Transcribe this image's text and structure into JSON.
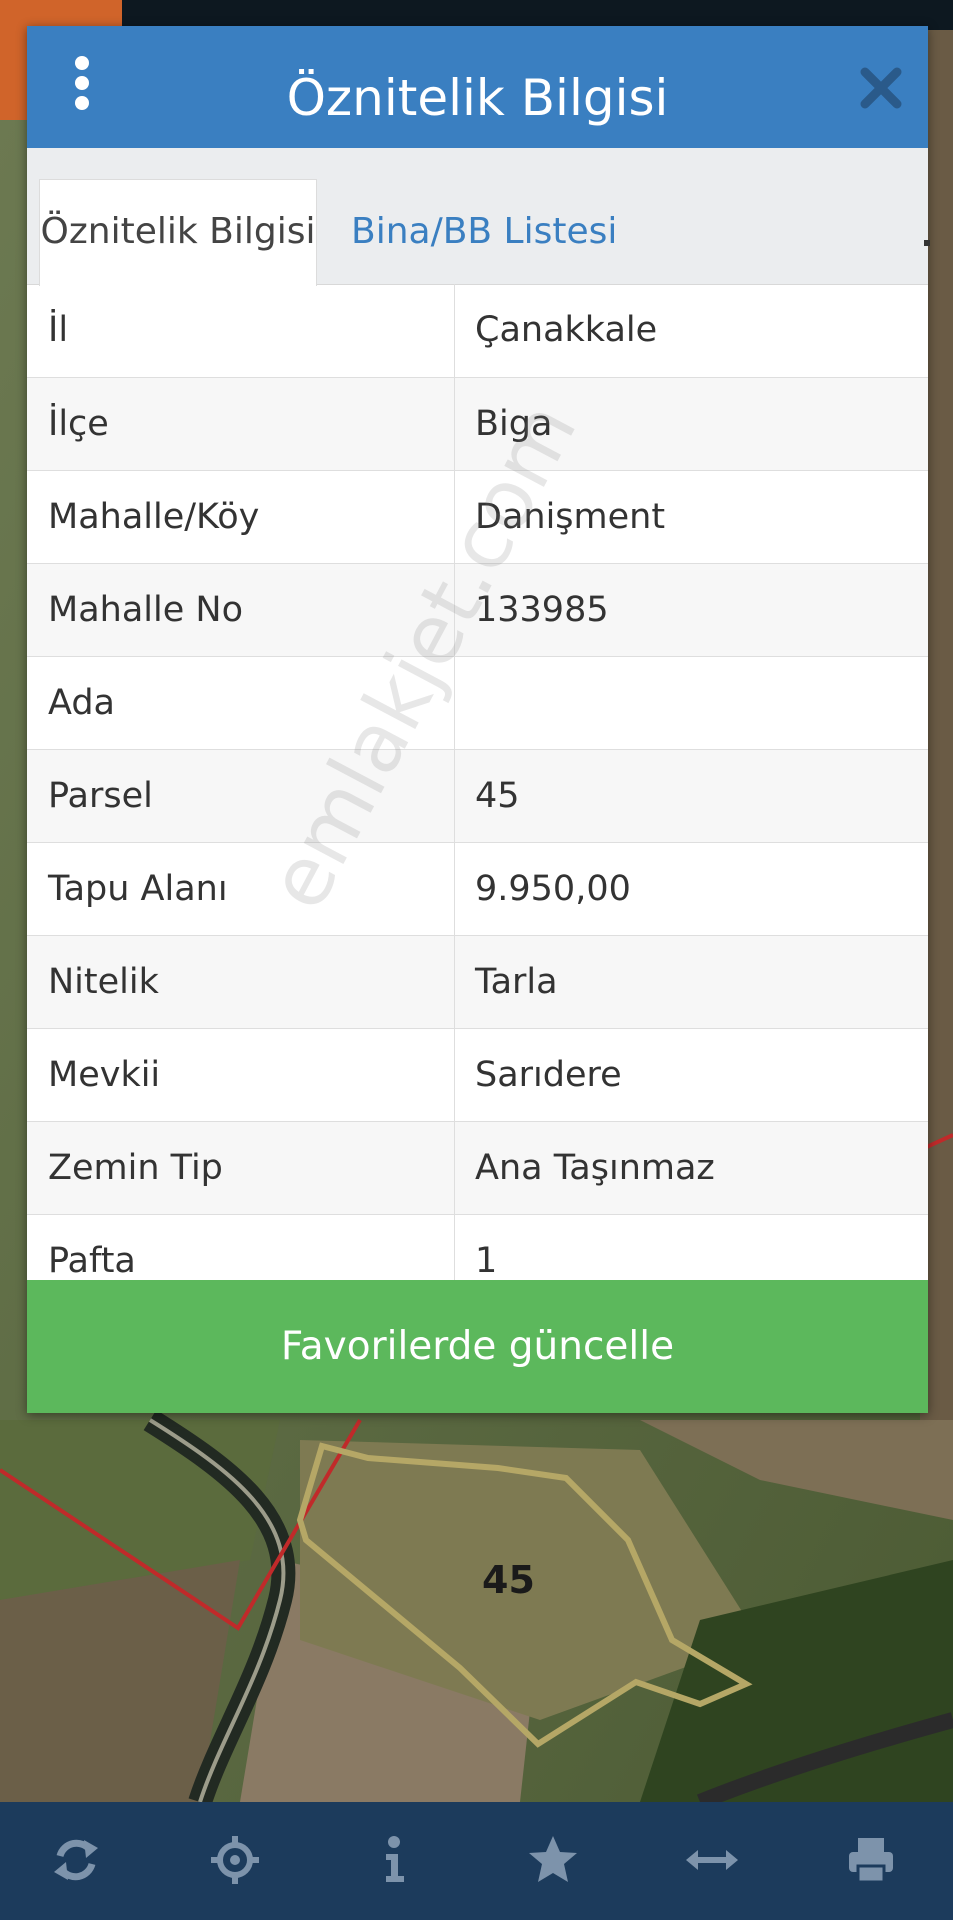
{
  "modal": {
    "title": "Öznitelik Bilgisi",
    "tabs": [
      {
        "label": "Öznitelik Bilgisi",
        "active": true
      },
      {
        "label": "Bina/BB Listesi",
        "active": false
      }
    ],
    "rows": [
      {
        "label": "İl",
        "value": "Çanakkale"
      },
      {
        "label": "İlçe",
        "value": "Biga"
      },
      {
        "label": "Mahalle/Köy",
        "value": "Danişment"
      },
      {
        "label": "Mahalle No",
        "value": "133985"
      },
      {
        "label": "Ada",
        "value": ""
      },
      {
        "label": "Parsel",
        "value": "45"
      },
      {
        "label": "Tapu Alanı",
        "value": "9.950,00"
      },
      {
        "label": "Nitelik",
        "value": "Tarla"
      },
      {
        "label": "Mevkii",
        "value": "Sarıdere"
      },
      {
        "label": "Zemin Tip",
        "value": "Ana Taşınmaz"
      },
      {
        "label": "Pafta",
        "value": "1"
      }
    ],
    "update_button": "Favorilerde güncelle"
  },
  "map": {
    "parcel_label": "45",
    "watermark": "emlakjet.com"
  },
  "toolbar": {
    "icons": [
      "refresh-icon",
      "locate-icon",
      "info-icon",
      "star-icon",
      "measure-icon",
      "print-icon"
    ]
  },
  "colors": {
    "header_blue": "#3a7fc1",
    "button_green": "#5cb85c",
    "toolbar_navy": "#1c3b5c",
    "parcel_outline": "#b5a766",
    "boundary_red": "#c02a2a"
  }
}
